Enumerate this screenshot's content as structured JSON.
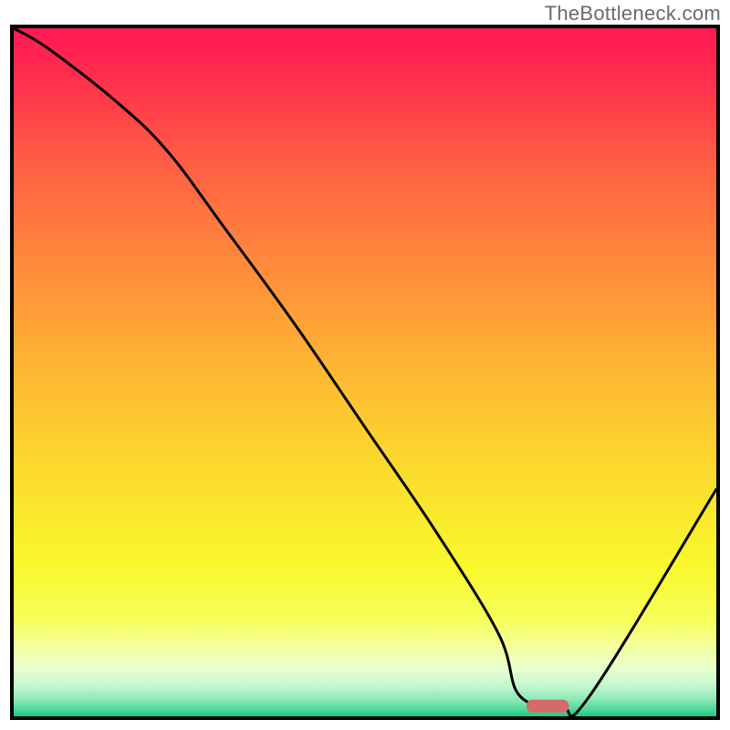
{
  "watermark": "TheBottleneck.com",
  "chart_data": {
    "type": "line",
    "title": "",
    "xlabel": "",
    "ylabel": "",
    "xlim": [
      0,
      100
    ],
    "ylim": [
      0,
      100
    ],
    "x": [
      0,
      5,
      15,
      22,
      30,
      40,
      50,
      60,
      69,
      72,
      78,
      82,
      100
    ],
    "values": [
      100,
      97,
      89,
      82,
      71,
      57,
      42,
      27,
      12,
      3,
      1.5,
      3,
      33
    ],
    "marker": {
      "x": 76,
      "y": 1.5,
      "width": 6
    },
    "gradient_stops": [
      {
        "offset": 0,
        "color": "#ff1a53"
      },
      {
        "offset": 0.06,
        "color": "#ff2a4e"
      },
      {
        "offset": 0.2,
        "color": "#ff6044"
      },
      {
        "offset": 0.35,
        "color": "#fe8c3b"
      },
      {
        "offset": 0.5,
        "color": "#fdb833"
      },
      {
        "offset": 0.65,
        "color": "#fbdc2e"
      },
      {
        "offset": 0.78,
        "color": "#f8f82c"
      },
      {
        "offset": 0.86,
        "color": "#f6ff5a"
      },
      {
        "offset": 0.9,
        "color": "#f3ffa0"
      },
      {
        "offset": 0.93,
        "color": "#e8ffd0"
      },
      {
        "offset": 0.955,
        "color": "#c4f8cf"
      },
      {
        "offset": 0.975,
        "color": "#8fe9b8"
      },
      {
        "offset": 0.99,
        "color": "#4fd89b"
      },
      {
        "offset": 1.0,
        "color": "#16c97f"
      }
    ]
  }
}
